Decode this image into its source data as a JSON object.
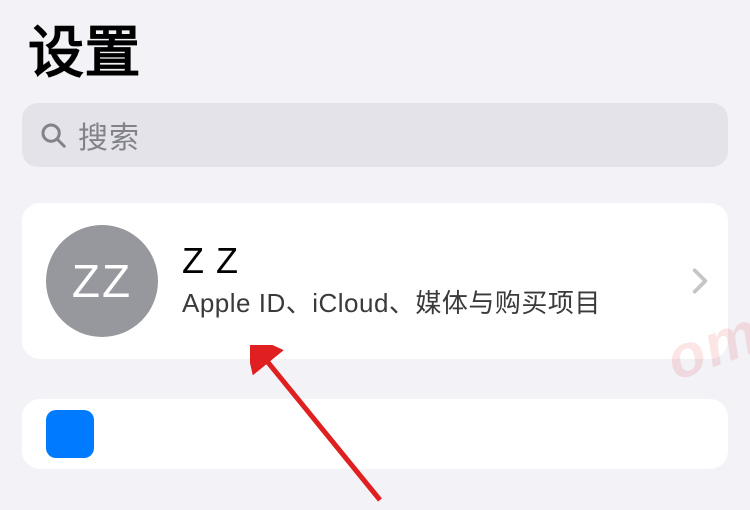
{
  "header": {
    "title": "设置"
  },
  "search": {
    "placeholder": "搜索"
  },
  "account": {
    "avatar_initials": "ZZ",
    "name": "Z Z",
    "subtitle": "Apple ID、iCloud、媒体与购买项目"
  },
  "colors": {
    "background": "#f2f2f7",
    "search_bg": "#e3e3e9",
    "placeholder": "#828289",
    "avatar_bg": "#97979e",
    "chevron": "#c5c5c9",
    "accent": "#007aff",
    "annotation": "#e02020"
  },
  "icons": {
    "search": "magnifying-glass",
    "chevron": "chevron-right"
  },
  "watermark": "om"
}
